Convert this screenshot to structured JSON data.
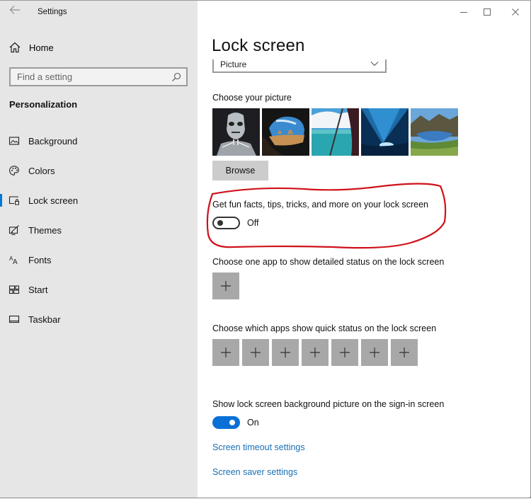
{
  "window": {
    "app_title": "Settings",
    "controls": {
      "minimize": "minimize",
      "maximize": "maximize",
      "close": "close"
    }
  },
  "sidebar": {
    "home_label": "Home",
    "search_placeholder": "Find a setting",
    "section_title": "Personalization",
    "items": [
      {
        "label": "Background",
        "icon": "background-icon",
        "active": false
      },
      {
        "label": "Colors",
        "icon": "palette-icon",
        "active": false
      },
      {
        "label": "Lock screen",
        "icon": "lock-screen-icon",
        "active": true
      },
      {
        "label": "Themes",
        "icon": "themes-icon",
        "active": false
      },
      {
        "label": "Fonts",
        "icon": "fonts-icon",
        "active": false
      },
      {
        "label": "Start",
        "icon": "start-icon",
        "active": false
      },
      {
        "label": "Taskbar",
        "icon": "taskbar-icon",
        "active": false
      }
    ]
  },
  "main": {
    "title": "Lock screen",
    "background_dropdown": {
      "selected": "Picture"
    },
    "choose_picture_label": "Choose your picture",
    "pictures": [
      {
        "name": "robot-skeleton"
      },
      {
        "name": "beach-cave"
      },
      {
        "name": "ocean-window"
      },
      {
        "name": "underwater-ice"
      },
      {
        "name": "mountain-lake"
      }
    ],
    "browse_label": "Browse",
    "fun_facts": {
      "label": "Get fun facts, tips, tricks, and more on your lock screen",
      "state": "Off"
    },
    "detailed_status_label": "Choose one app to show detailed status on the lock screen",
    "detailed_status_slots": 1,
    "quick_status_label": "Choose which apps show quick status on the lock screen",
    "quick_status_slots": 7,
    "signin_background": {
      "label": "Show lock screen background picture on the sign-in screen",
      "state": "On"
    },
    "links": {
      "screen_timeout": "Screen timeout settings",
      "screen_saver": "Screen saver settings"
    }
  },
  "colors": {
    "accent": "#0078d7",
    "toggle_on": "#0a70d6",
    "link": "#1a6fb5",
    "sidebar_bg": "#e6e6e6",
    "tile_bg": "#a8a8a8",
    "annotation": "#d0121b"
  }
}
